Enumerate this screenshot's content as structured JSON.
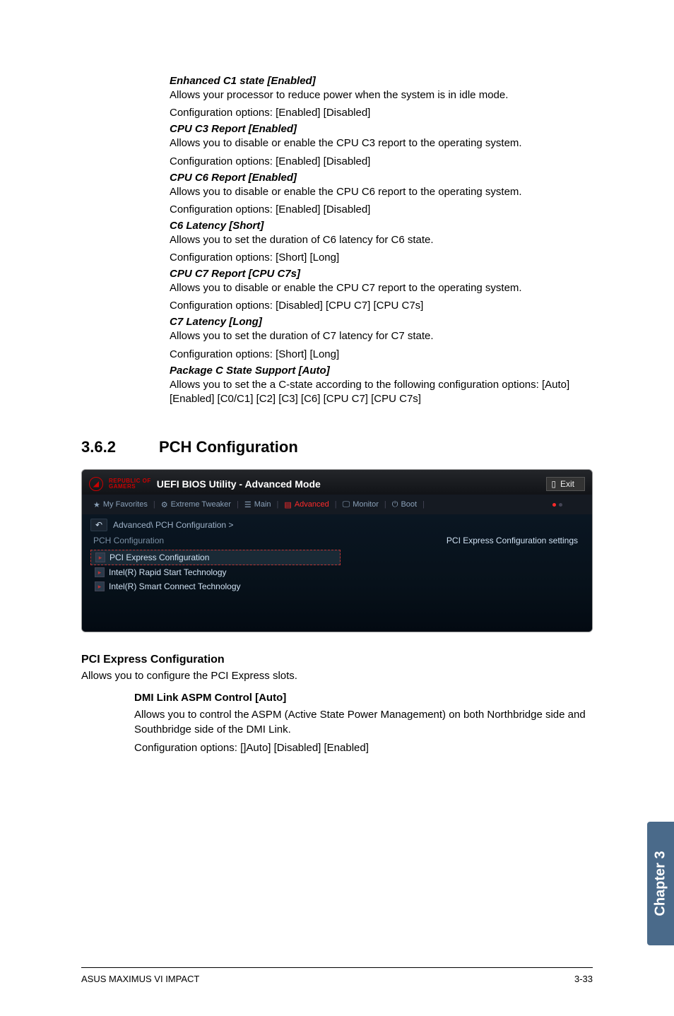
{
  "settings": {
    "enhanced_c1": {
      "title": "Enhanced C1 state [Enabled]",
      "desc": "Allows your processor to reduce power when the system is in idle mode.",
      "opts": "Configuration options: [Enabled] [Disabled]"
    },
    "cpu_c3": {
      "title": "CPU C3 Report [Enabled]",
      "desc": "Allows you to disable or enable the CPU C3 report to the operating system.",
      "opts": "Configuration options: [Enabled] [Disabled]"
    },
    "cpu_c6": {
      "title": "CPU C6 Report [Enabled]",
      "desc": "Allows you to disable or enable the CPU C6 report to the operating system.",
      "opts": "Configuration options: [Enabled] [Disabled]"
    },
    "c6_latency": {
      "title": "C6 Latency [Short]",
      "desc": "Allows you to set the duration of C6 latency for C6 state.",
      "opts": "Configuration options: [Short] [Long]"
    },
    "cpu_c7": {
      "title": "CPU C7 Report [CPU C7s]",
      "desc": "Allows you to disable or enable the CPU C7 report to the operating system.",
      "opts": "Configuration options: [Disabled] [CPU C7] [CPU C7s]"
    },
    "c7_latency": {
      "title": "C7 Latency [Long]",
      "desc": "Allows you to set the duration of C7 latency for C7 state.",
      "opts": "Configuration options: [Short] [Long]"
    },
    "package_c": {
      "title": "Package C State Support [Auto]",
      "desc": "Allows you to set the a C-state according to the following configuration options: [Auto] [Enabled] [C0/C1] [C2] [C3] [C6] [CPU C7] [CPU C7s]"
    }
  },
  "section": {
    "number": "3.6.2",
    "title": "PCH Configuration"
  },
  "bios": {
    "brand_line1": "REPUBLIC OF",
    "brand_line2": "GAMERS",
    "title": "UEFI BIOS Utility - Advanced Mode",
    "exit": "Exit",
    "tabs": {
      "fav": "My Favorites",
      "tweaker": "Extreme Tweaker",
      "main": "Main",
      "advanced": "Advanced",
      "monitor": "Monitor",
      "boot": "Boot"
    },
    "breadcrumb": "Advanced\\ PCH Configuration >",
    "heading": "PCH Configuration",
    "items": {
      "pci": "PCI Express Configuration",
      "rst": "Intel(R) Rapid Start Technology",
      "sct": "Intel(R) Smart Connect Technology"
    },
    "help": "PCI Express Configuration settings"
  },
  "pci_express": {
    "title": "PCI Express Configuration",
    "desc": "Allows you to configure the PCI Express slots.",
    "dmi": {
      "title": "DMI Link ASPM Control [Auto]",
      "desc": "Allows you to control the ASPM (Active State Power Management) on both Northbridge side and Southbridge side of the DMI Link.",
      "opts": "Configuration options: []Auto] [Disabled] [Enabled]"
    }
  },
  "side_tab": "Chapter 3",
  "footer": {
    "left": "ASUS MAXIMUS VI IMPACT",
    "right": "3-33"
  }
}
